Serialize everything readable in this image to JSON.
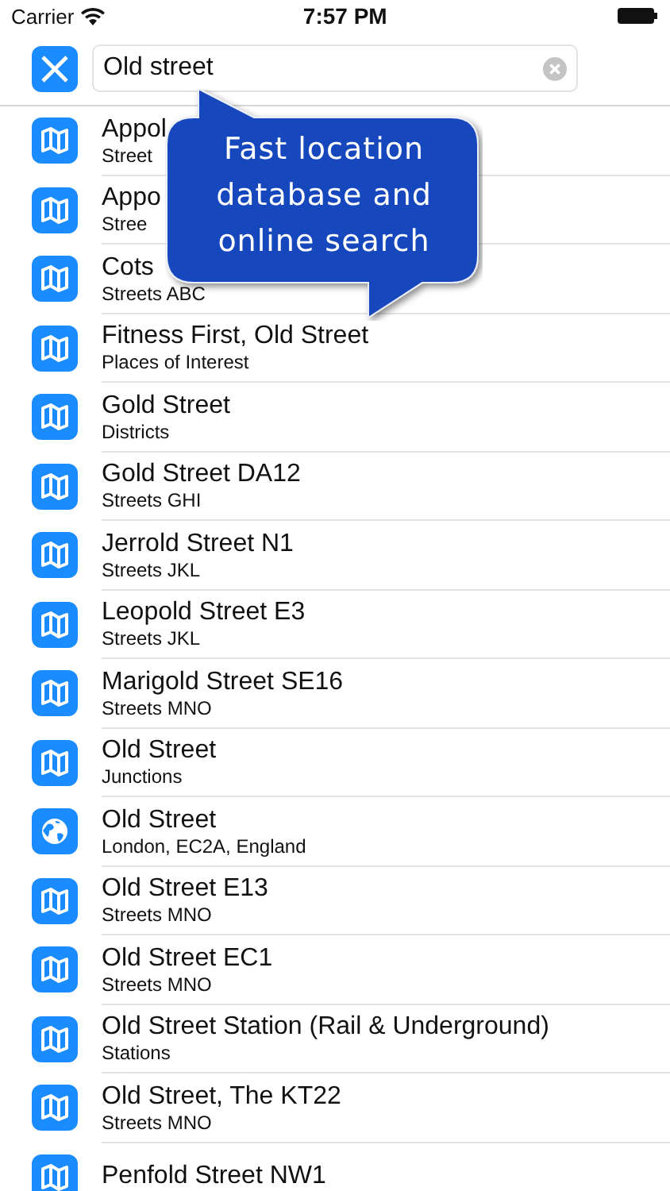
{
  "status_bar": {
    "carrier": "Carrier",
    "time": "7:57 PM"
  },
  "search": {
    "value": "Old street"
  },
  "callout": {
    "text": "Fast location database and online search"
  },
  "results": [
    {
      "kind": "map",
      "title": "Appol",
      "subtitle": "Street"
    },
    {
      "kind": "map",
      "title": "Appo",
      "subtitle": "Stree"
    },
    {
      "kind": "map",
      "title": "Cots",
      "subtitle": "Streets ABC"
    },
    {
      "kind": "map",
      "title": "Fitness First, Old Street",
      "subtitle": "Places of Interest"
    },
    {
      "kind": "map",
      "title": "Gold Street",
      "subtitle": "Districts"
    },
    {
      "kind": "map",
      "title": "Gold Street DA12",
      "subtitle": "Streets GHI"
    },
    {
      "kind": "map",
      "title": "Jerrold Street N1",
      "subtitle": "Streets JKL"
    },
    {
      "kind": "map",
      "title": "Leopold Street E3",
      "subtitle": "Streets JKL"
    },
    {
      "kind": "map",
      "title": "Marigold Street SE16",
      "subtitle": "Streets MNO"
    },
    {
      "kind": "map",
      "title": "Old Street",
      "subtitle": "Junctions"
    },
    {
      "kind": "globe",
      "title": "Old Street",
      "subtitle": "London, EC2A, England"
    },
    {
      "kind": "map",
      "title": "Old Street E13",
      "subtitle": "Streets MNO"
    },
    {
      "kind": "map",
      "title": "Old Street EC1",
      "subtitle": "Streets MNO"
    },
    {
      "kind": "map",
      "title": "Old Street Station (Rail & Underground)",
      "subtitle": "Stations"
    },
    {
      "kind": "map",
      "title": "Old Street, The KT22",
      "subtitle": "Streets MNO"
    },
    {
      "kind": "map",
      "title": "Penfold Street NW1"
    }
  ]
}
